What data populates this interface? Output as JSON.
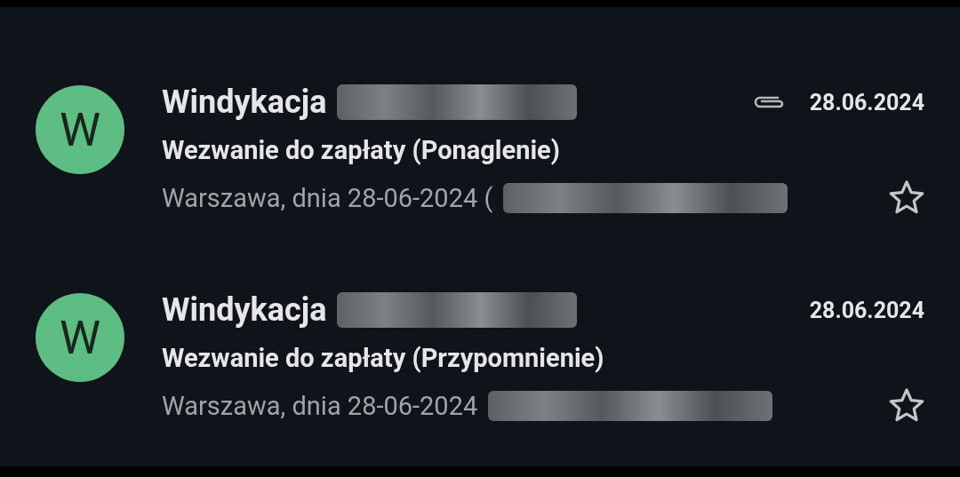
{
  "emails": [
    {
      "avatar": "W",
      "sender": "Windykacja",
      "subject": "Wezwanie do zapłaty (Ponaglenie)",
      "snippet": "Warszawa, dnia 28-06-2024 (",
      "date": "28.06.2024",
      "attachment": true,
      "starred": false
    },
    {
      "avatar": "W",
      "sender": "Windykacja",
      "subject": "Wezwanie do zapłaty (Przypomnienie)",
      "snippet": "Warszawa, dnia 28-06-2024",
      "date": "28.06.2024",
      "attachment": false,
      "starred": false
    }
  ]
}
